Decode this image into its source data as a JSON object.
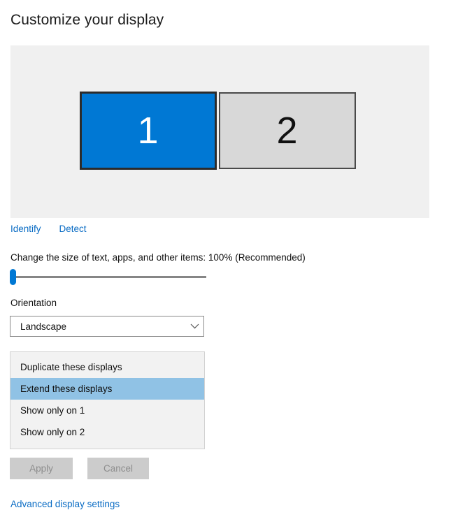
{
  "page": {
    "title": "Customize your display"
  },
  "preview": {
    "monitors": [
      {
        "number": "1",
        "state": "selected",
        "color": "#0078d4"
      },
      {
        "number": "2",
        "state": "normal",
        "color": "#d8d8d8"
      }
    ]
  },
  "links": {
    "identify": "Identify",
    "detect": "Detect"
  },
  "scale": {
    "label": "Change the size of text, apps, and other items: 100% (Recommended)",
    "value": "100%",
    "slider_position_percent": 0
  },
  "orientation": {
    "label": "Orientation",
    "selected": "Landscape",
    "chevron": "chevron-down-icon"
  },
  "multiple_displays": {
    "options": [
      "Duplicate these displays",
      "Extend these displays",
      "Show only on 1",
      "Show only on 2"
    ],
    "selected_index": 1,
    "highlight_color": "#90c2e5"
  },
  "buttons": {
    "apply": "Apply",
    "cancel": "Cancel",
    "enabled": false
  },
  "footer": {
    "advanced_link": "Advanced display settings"
  },
  "accent_color": "#0078d4",
  "link_color": "#0a6cc4"
}
